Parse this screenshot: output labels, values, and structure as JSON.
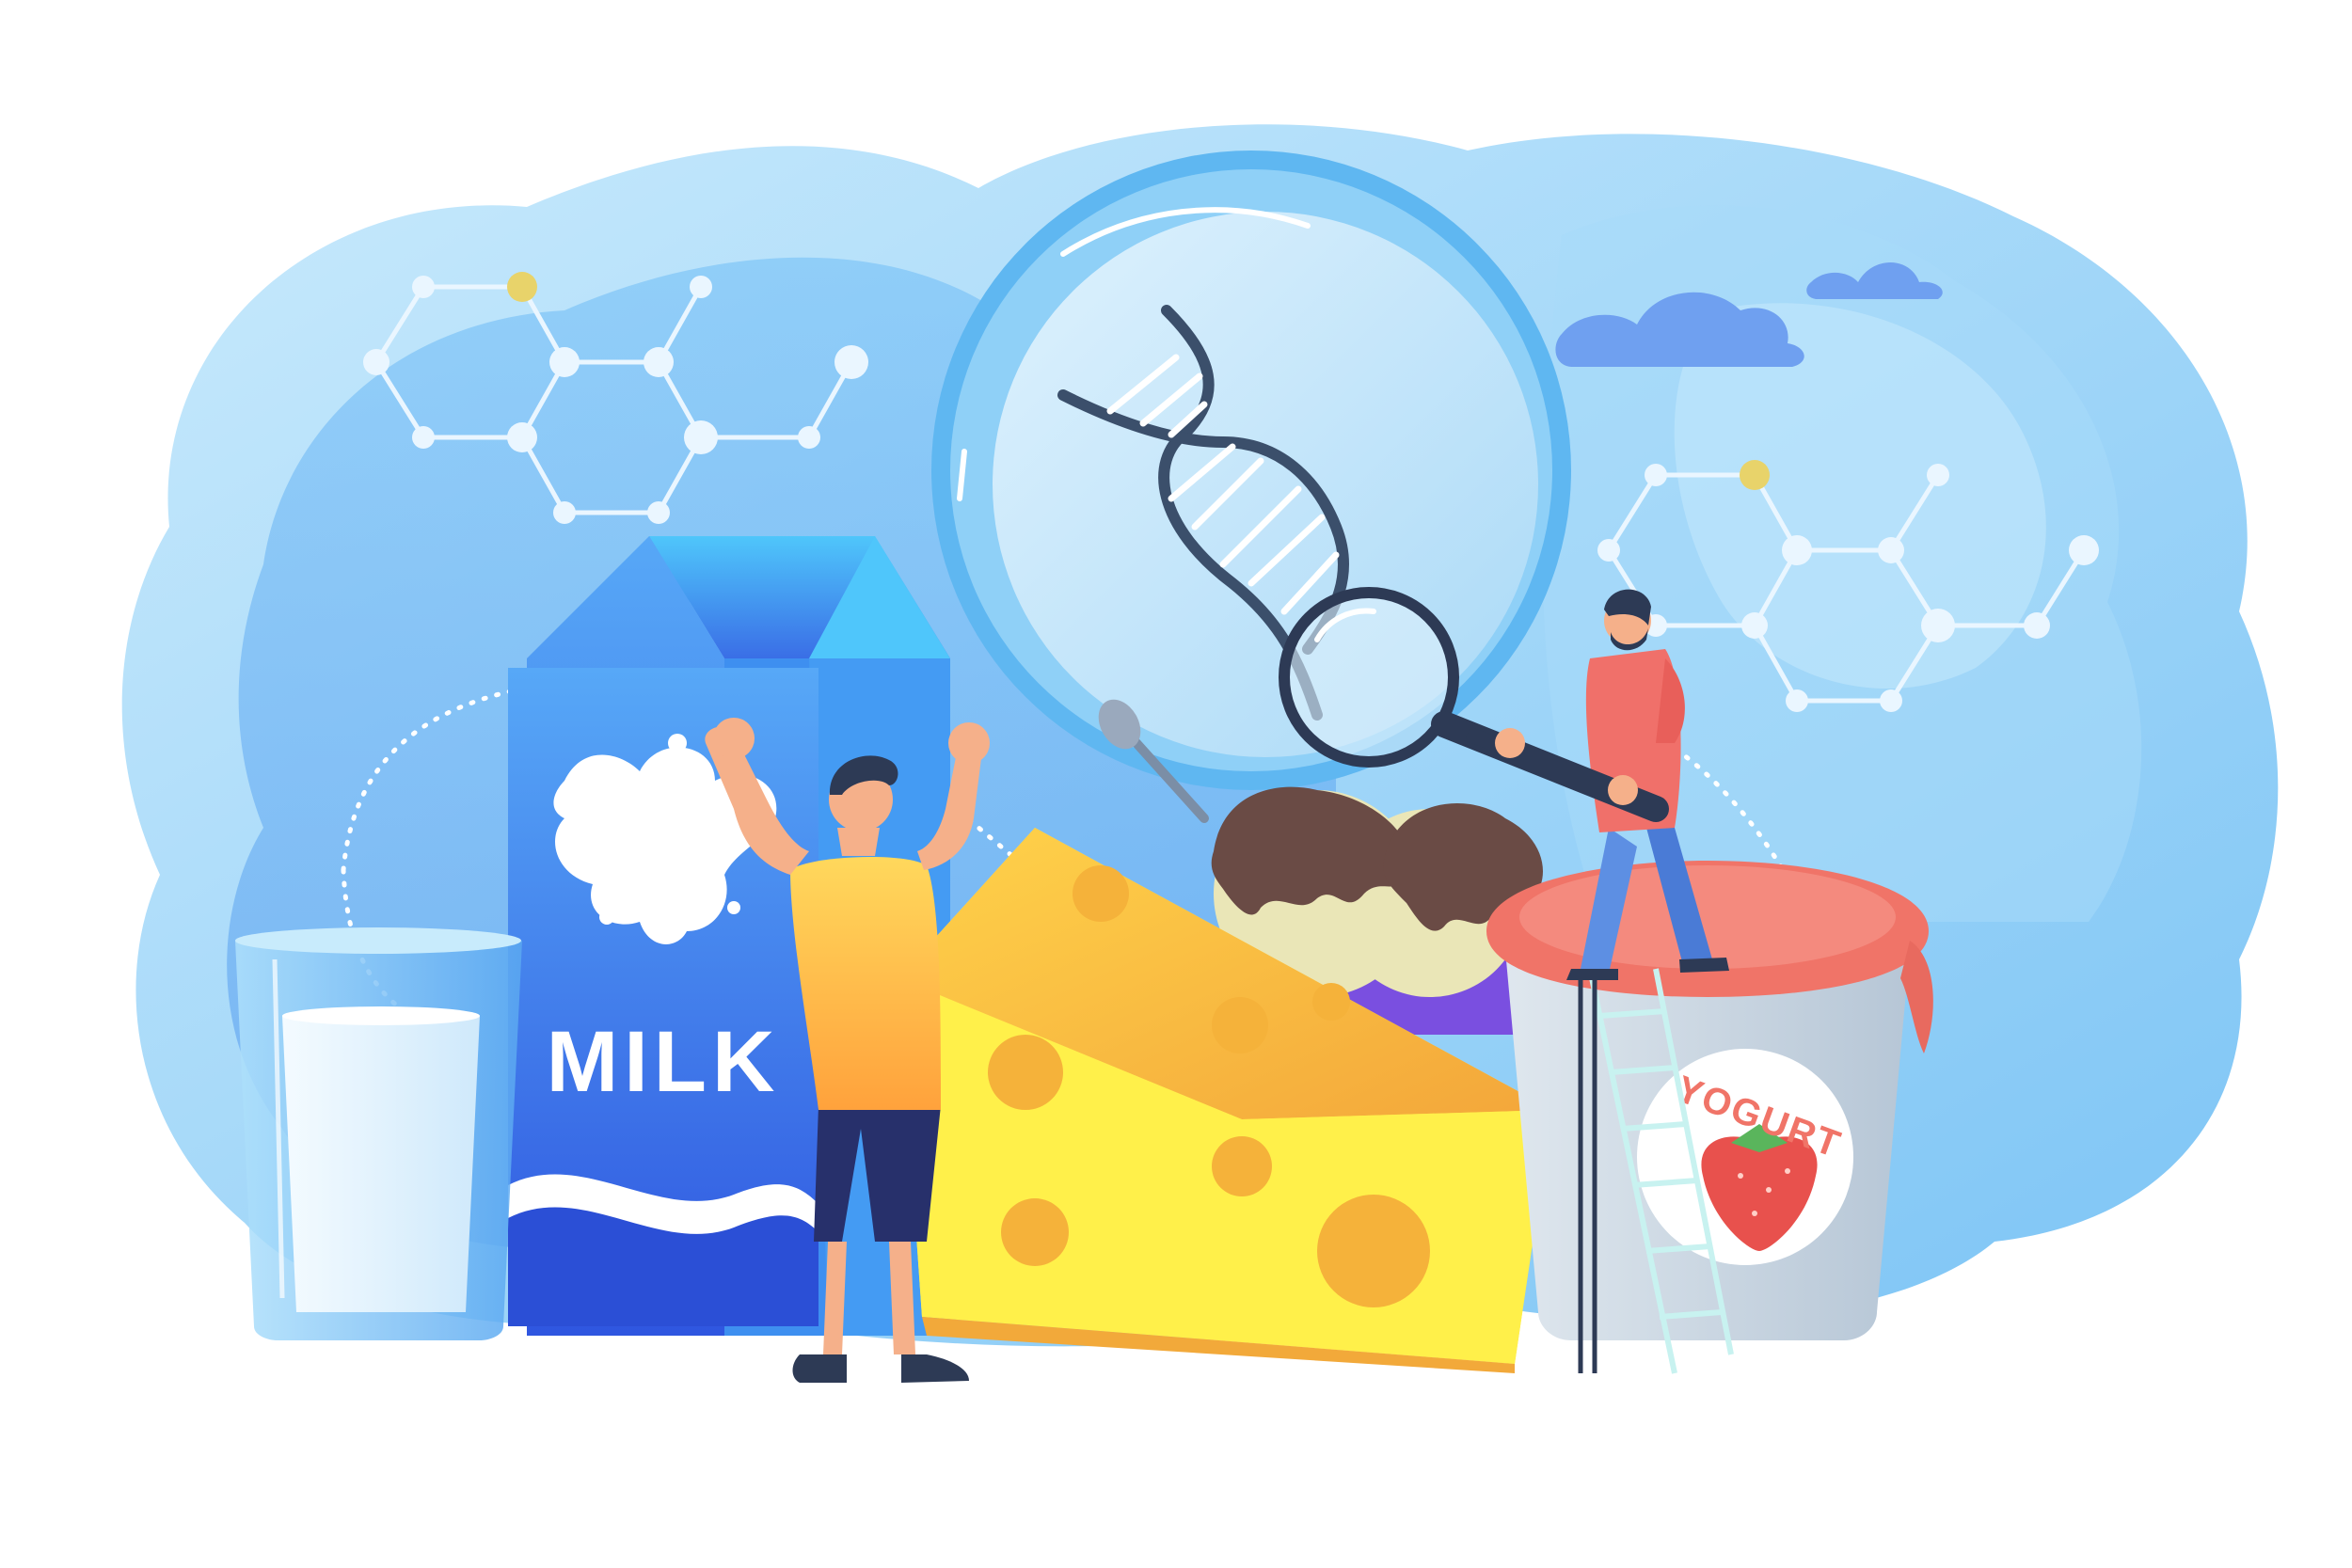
{
  "illustration": {
    "milk_label": "MILK",
    "yogurt_label": "YOGURT"
  },
  "palette": {
    "background": "#ffffff",
    "blob_light": "#bfe4fb",
    "blob_mid": "#8fd0f7",
    "blob_deep": "#5fb2ef",
    "carton_blue": "#3f7df0",
    "carton_dark": "#2b4fd6",
    "cheese_yellow": "#ffd84a",
    "cheese_hole": "#f5b23a",
    "yogurt_lid": "#f07468",
    "skin": "#f5b08a",
    "shirt_yellow": "#ffc93c",
    "shorts_navy": "#27306b",
    "shirt_coral": "#f0706a",
    "jeans_blue": "#5d8fe3",
    "molecule_white": "#eaf6ff",
    "molecule_yellow": "#e8d36a"
  },
  "icons": [
    "dna-helix-icon",
    "magnifier-icon",
    "molecule-icon",
    "cloud-icon",
    "strawberry-icon",
    "milk-splash-icon"
  ]
}
